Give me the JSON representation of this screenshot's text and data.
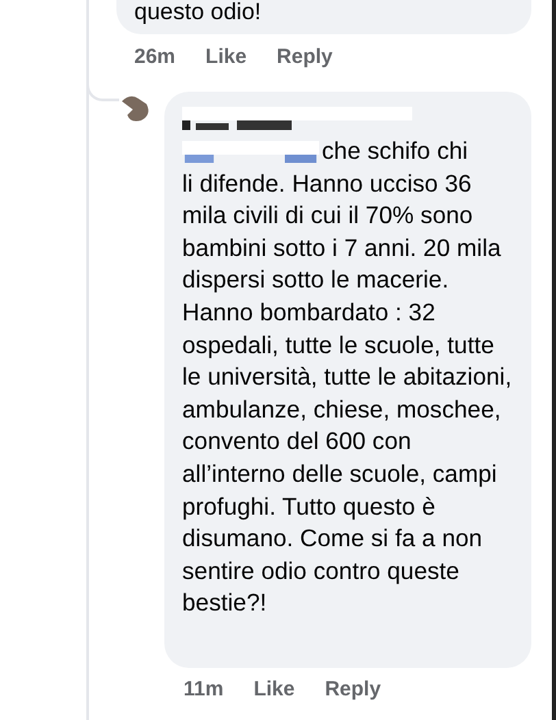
{
  "previous_comment": {
    "text_tail": "questo odio!",
    "time": "26m",
    "like": "Like",
    "reply": "Reply"
  },
  "reply_comment": {
    "first_line": "che schifo chi",
    "text": "li difende. Hanno ucciso 36 mila civili di cui il 70% sono bambini sotto i 7 anni. 20 mila dispersi sotto le macerie. Hanno bombardato : 32 ospedali, tutte le scuole, tutte le università, tutte le abitazioni, ambulanze, chiese, moschee, convento del 600 con all’interno delle scuole, campi profughi. Tutto questo è disumano. Come si fa a non sentire odio contro queste bestie?!",
    "time": "11m",
    "like": "Like",
    "reply": "Reply"
  }
}
